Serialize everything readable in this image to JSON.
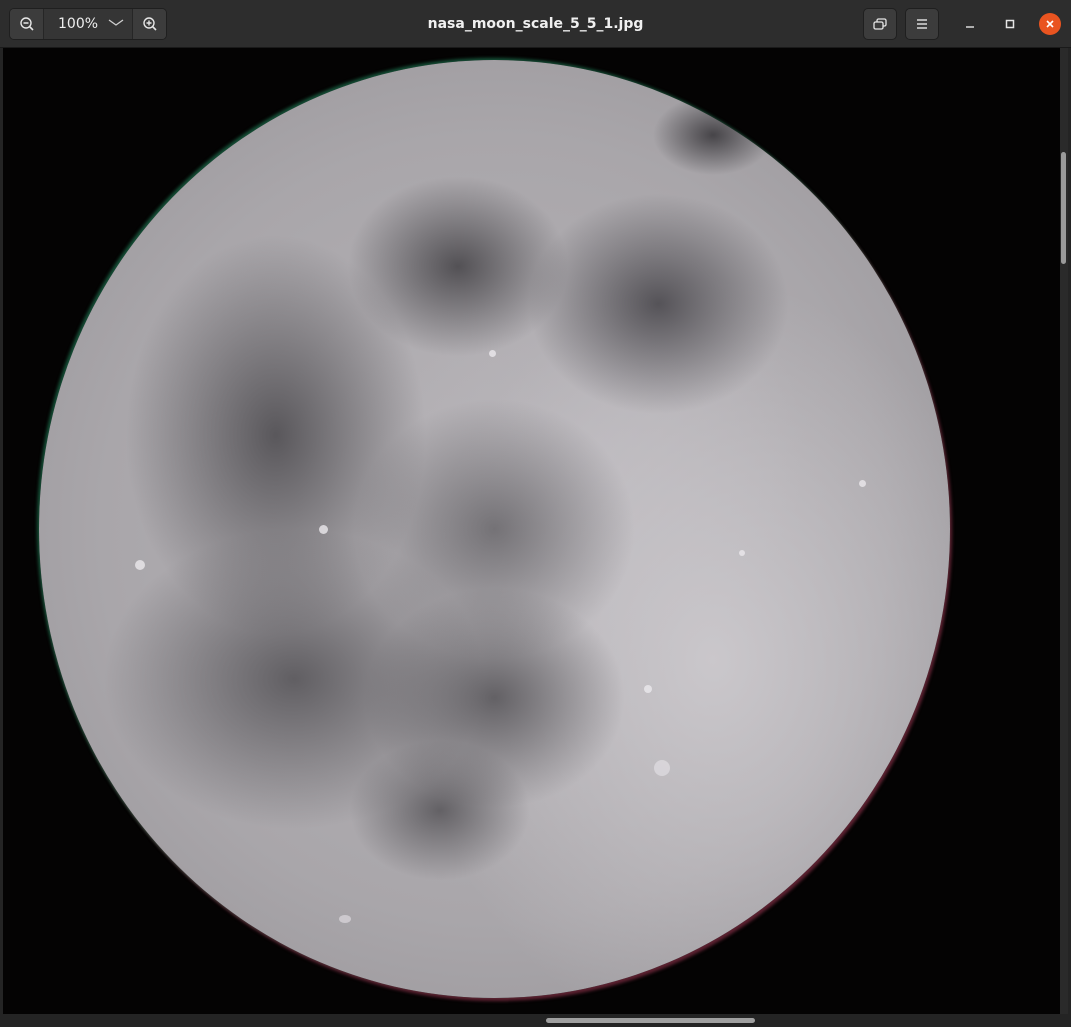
{
  "window": {
    "title": "nasa_moon_scale_5_5_1.jpg"
  },
  "toolbar": {
    "zoom_out_icon": "zoom-out-icon",
    "zoom_level": "100%",
    "zoom_dropdown_icon": "chevron-down-icon",
    "zoom_in_icon": "zoom-in-icon",
    "view_toggle_icon": "restore-view-icon",
    "menu_icon": "hamburger-menu-icon"
  },
  "window_controls": {
    "minimize_icon": "minimize-icon",
    "maximize_icon": "maximize-icon",
    "close_icon": "close-icon",
    "close_color": "#e95420"
  },
  "image": {
    "subject": "full moon photograph"
  }
}
